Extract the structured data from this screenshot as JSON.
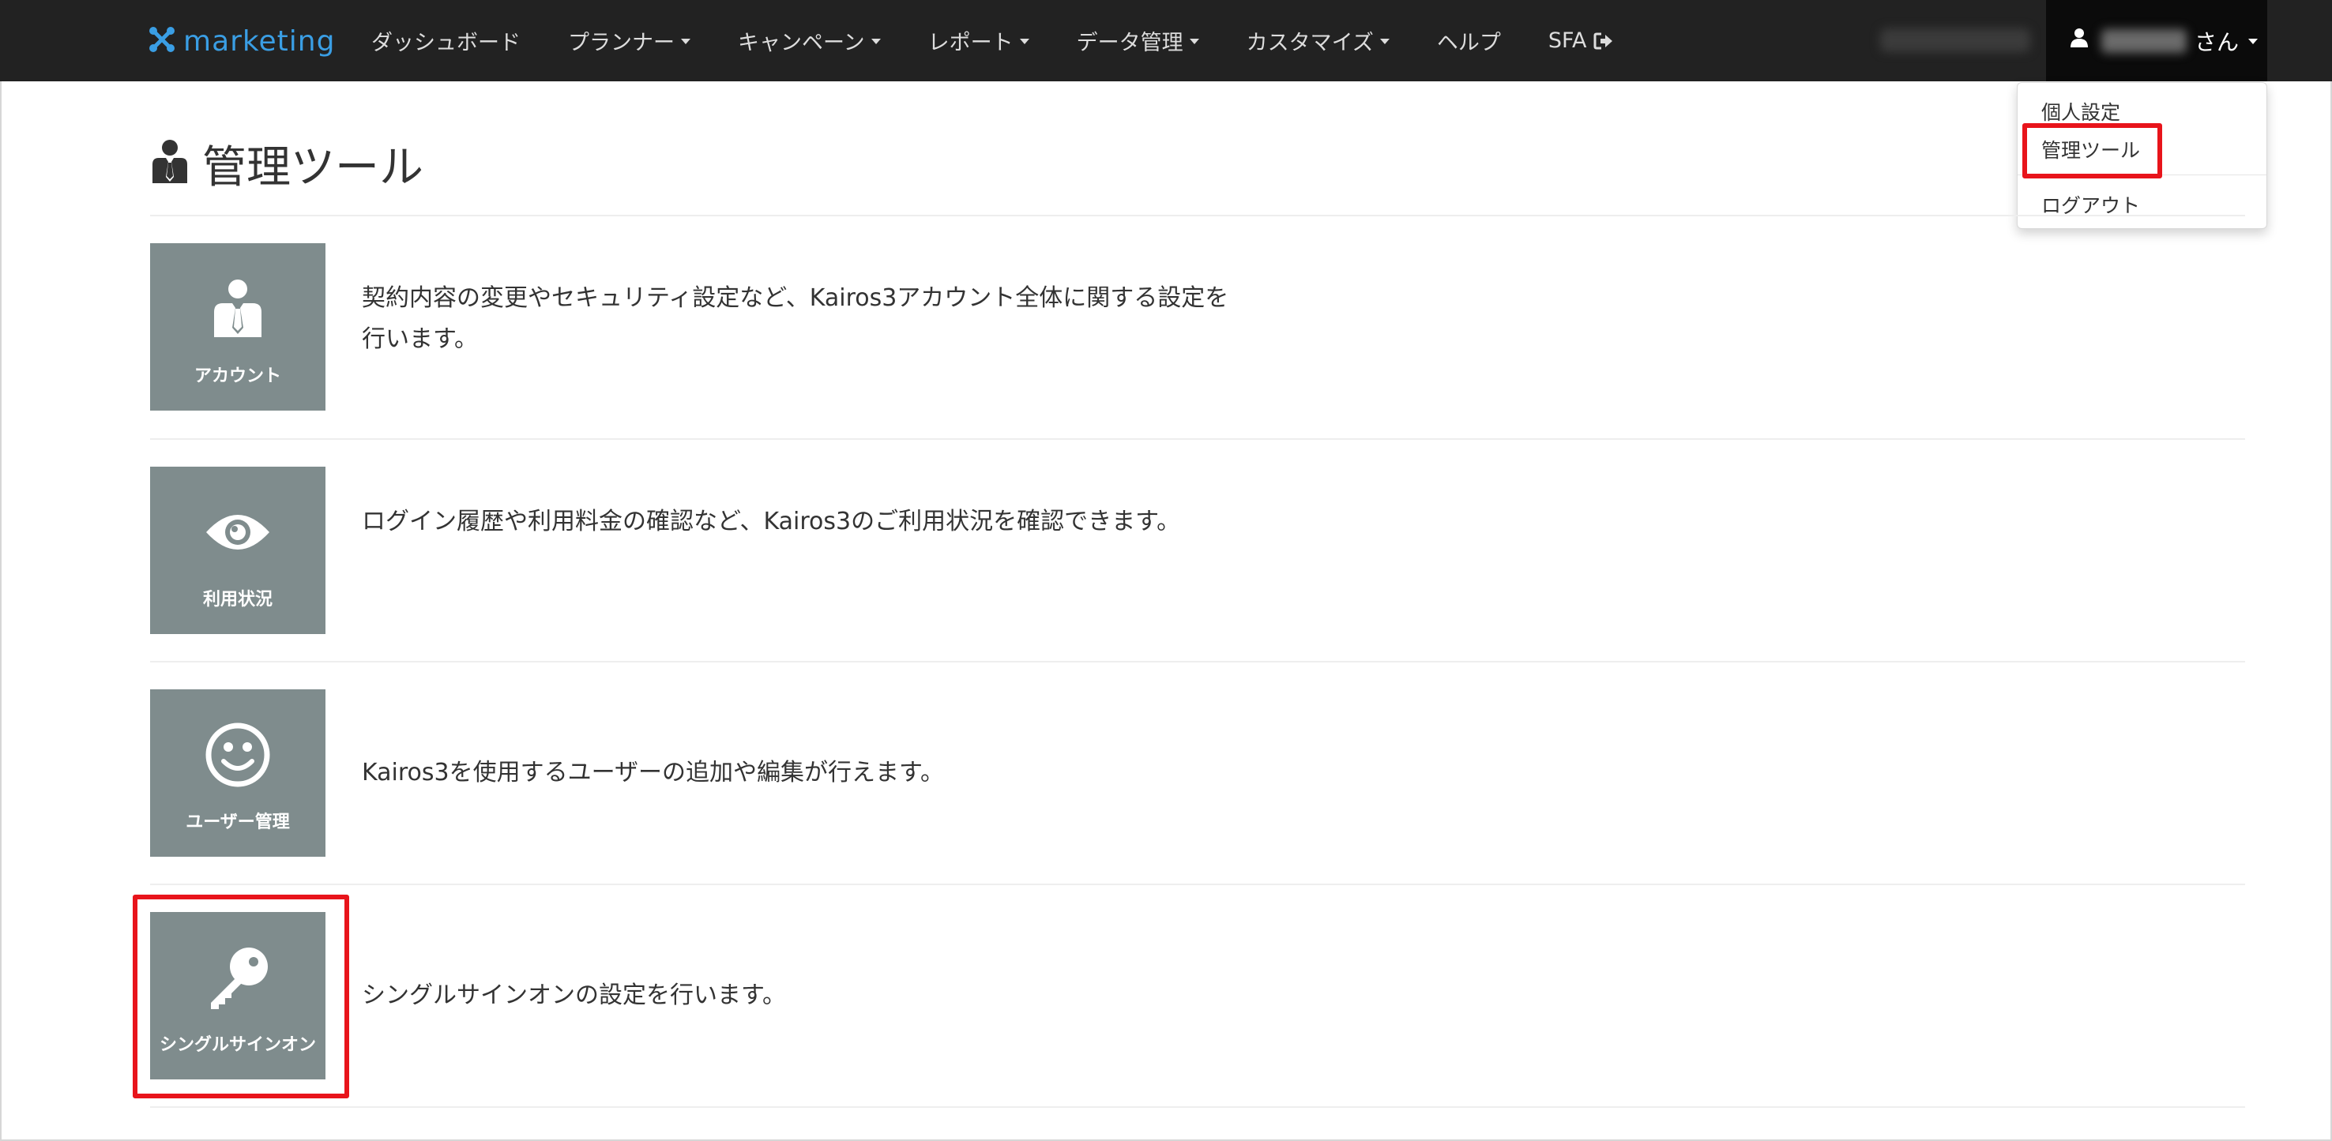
{
  "navbar": {
    "brand": "marketing",
    "items": [
      {
        "label": "ダッシュボード",
        "dropdown": false
      },
      {
        "label": "プランナー",
        "dropdown": true
      },
      {
        "label": "キャンペーン",
        "dropdown": true
      },
      {
        "label": "レポート",
        "dropdown": true
      },
      {
        "label": "データ管理",
        "dropdown": true
      },
      {
        "label": "カスタマイズ",
        "dropdown": true
      },
      {
        "label": "ヘルプ",
        "dropdown": false
      },
      {
        "label": "SFA",
        "dropdown": false
      }
    ],
    "user_suffix": "さん"
  },
  "user_menu": {
    "personal_settings": "個人設定",
    "admin_tools": "管理ツール",
    "logout": "ログアウト"
  },
  "page": {
    "title": "管理ツール",
    "tools": [
      {
        "label": "アカウント",
        "icon": "user-suit-icon",
        "description": "契約内容の変更やセキュリティ設定など、Kairos3アカウント全体に関する設定を行います。"
      },
      {
        "label": "利用状況",
        "icon": "eye-icon",
        "description": "ログイン履歴や利用料金の確認など、Kairos3のご利用状況を確認できます。"
      },
      {
        "label": "ユーザー管理",
        "icon": "smiley-icon",
        "description": "Kairos3を使用するユーザーの追加や編集が行えます。"
      },
      {
        "label": "シングルサインオン",
        "icon": "key-icon",
        "description": "シングルサインオンの設定を行います。"
      }
    ]
  },
  "colors": {
    "navbar_bg": "#222222",
    "brand": "#3a9ee4",
    "tile_bg": "#7f8c8d",
    "highlight": "#e8141b"
  }
}
